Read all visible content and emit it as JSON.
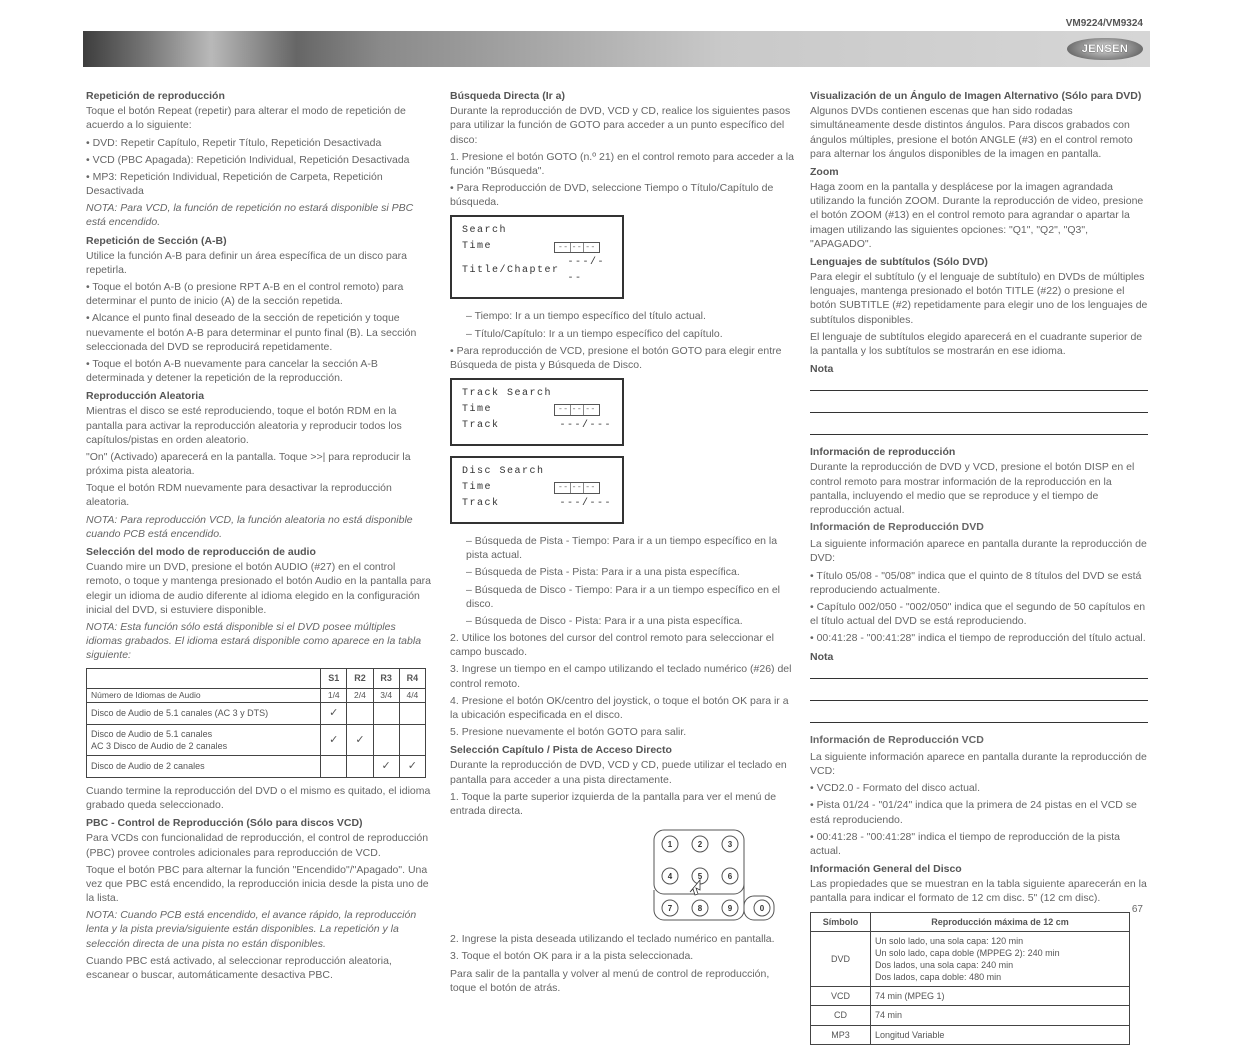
{
  "header": {
    "brand": "JENSEN",
    "model": "VM9224/VM9324"
  },
  "col1": {
    "heading_repeat": "Repetición de reproducción",
    "repeat_p1": "Toque el botón Repeat (repetir) para alterar el modo de repetición de acuerdo a lo siguiente:",
    "repeat_li1": "DVD: Repetir Capítulo, Repetir Título, Repetición Desactivada",
    "repeat_li2": "VCD (PBC Apagada): Repetición Individual, Repetición Desactivada",
    "repeat_li3": "MP3: Repetición Individual, Repetición de Carpeta, Repetición Desactivada",
    "repeat_note": "NOTA: Para VCD, la función de repetición no estará disponible si PBC está encendido.",
    "heading_section": "Repetición de Sección (A-B)",
    "section_p": "Utilice la función A-B para definir un área específica de un disco para repetirla.",
    "section_li1": "Toque el botón A-B (o presione RPT A-B en el control remoto) para determinar el punto de inicio (A) de la sección repetida.",
    "section_li2": "Alcance el punto final deseado de la sección de repetición y toque nuevamente el botón A-B para determinar el punto final (B). La sección seleccionada del DVD se reproducirá repetidamente.",
    "section_li3": "Toque el botón A-B nuevamente para cancelar la sección A-B determinada y detener la repetición de la reproducción.",
    "heading_random": "Reproducción Aleatoria",
    "random_p1": "Mientras el disco se esté reproduciendo, toque el botón RDM en la pantalla para activar la reproducción aleatoria y reproducir todos los capítulos/pistas en orden aleatorio.",
    "random_p2": "\"On\" (Activado) aparecerá en la pantalla. Toque >>| para reproducir la próxima pista aleatoria.",
    "random_p3": "Toque el botón RDM nuevamente para desactivar la reproducción aleatoria.",
    "random_note": "NOTA: Para reproducción VCD, la función aleatoria no está disponible cuando PCB está encendido.",
    "heading_a": "Selección del modo de reproducción de audio",
    "a_p1": "Cuando mire un DVD, presione el botón AUDIO (#27) en el control remoto, o toque y mantenga presionado el botón Audio en la pantalla para elegir un idioma de audio diferente al idioma elegido en la configuración inicial del DVD, si estuviere disponible.",
    "a_note": "NOTA: Esta función sólo está disponible si el DVD posee múltiples idiomas grabados. El idioma estará disponible como aparece en la tabla siguiente:",
    "table": {
      "head": [
        "",
        "S1",
        "R2",
        "R3",
        "R4"
      ],
      "label_row_head": "Número de Idiomas de Audio",
      "label_row": [
        "1/4",
        "2/4",
        "3/4",
        "4/4"
      ],
      "rows": [
        {
          "li": [
            "Disco de Audio de 5.1 canales (AC 3 y DTS)"
          ],
          "c": [
            "✓",
            "",
            "",
            ""
          ]
        },
        {
          "li": [
            "Disco de Audio de 5.1 canales",
            "AC 3 Disco de Audio de 2 canales"
          ],
          "c": [
            "✓",
            "✓",
            "",
            ""
          ]
        },
        {
          "li": [
            "Disco de Audio de 2 canales"
          ],
          "c": [
            "",
            "",
            "✓",
            "✓"
          ]
        }
      ]
    },
    "a_p2": "Cuando termine la reproducción del DVD o el mismo es quitado, el idioma grabado queda seleccionado.",
    "heading_pbc": "PBC - Control de Reproducción (Sólo para discos VCD)",
    "pbc_p1": "Para VCDs con funcionalidad de reproducción, el control de reproducción (PBC) provee controles adicionales para reproducción de VCD.",
    "pbc_p2": "Toque el botón PBC para alternar la función \"Encendido\"/\"Apagado\". Una vez que PBC está encendido, la reproducción inicia desde la pista uno de la lista.",
    "pbc_note": "NOTA: Cuando PCB está encendido, el avance rápido, la reproducción lenta y la pista previa/siguiente están disponibles. La repetición y la selección directa de una pista no están disponibles.",
    "pbc_p3": "Cuando PBC está activado, al seleccionar reproducción aleatoria, escanear o buscar, automáticamente desactiva PBC."
  },
  "col2": {
    "heading_goto": "Búsqueda Directa (Ir a)",
    "goto_p1": "Durante la reproducción de DVD, VCD y CD, realice los siguientes pasos para utilizar la función de GOTO para acceder a un punto específico del disco:",
    "goto_li1": "Presione el botón GOTO (n.º 21) en el control remoto para acceder a la función \"Búsqueda\".",
    "goto_dvdline": "Para Reproducción de DVD, seleccione Tiempo o Título/Capítulo de búsqueda.",
    "osd1": {
      "title": "Search",
      "time": "Time",
      "field": "-- -- --",
      "tc": "Title/Chapter",
      "tcval": "---/---"
    },
    "goto_dvd_sub1": "Tiempo: Ir a un tiempo específico del título actual.",
    "goto_dvd_sub2": "Título/Capítulo: Ir a un tiempo específico del capítulo.",
    "goto_vcdline": "Para reproducción de VCD, presione el botón GOTO para elegir entre Búsqueda de pista y Búsqueda de Disco.",
    "osd2": {
      "title": "Track Search",
      "time": "Time",
      "track": "Track",
      "tv": "---/---"
    },
    "osd3": {
      "title": "Disc Search",
      "time": "Time",
      "track": "Track",
      "tv": "---/---"
    },
    "goto_vcd_sub1": "Búsqueda de Pista - Tiempo: Para ir a un tiempo específico en la pista actual.",
    "goto_vcd_sub2": "Búsqueda de Pista - Pista: Para ir a una pista específica.",
    "goto_vcd_sub3": "Búsqueda de Disco - Tiempo: Para ir a un tiempo específico en el disco.",
    "goto_vcd_sub4": "Búsqueda de Disco - Pista: Para ir a una pista específica.",
    "goto_li2": "Utilice los botones del cursor del control remoto para seleccionar el campo buscado.",
    "goto_li3": "Ingrese un tiempo en el campo utilizando el teclado numérico (#26) del control remoto.",
    "goto_li4": "Presione el botón OK/centro del joystick, o toque el botón OK para ir a la ubicación especificada en el disco.",
    "goto_li5": "Presione nuevamente el botón GOTO para salir.",
    "heading_direct": "Selección Capítulo / Pista de Acceso Directo",
    "direct_p": "Durante la reproducción de DVD, VCD y CD, puede utilizar el teclado en pantalla para acceder a una pista directamente.",
    "direct_li1": "Toque la parte superior izquierda de la pantalla para ver el menú de entrada directa.",
    "direct_li2": "Ingrese la pista deseada utilizando el teclado numérico en pantalla.",
    "direct_li3": "Toque el botón OK para ir a la pista seleccionada.",
    "direct_exit": "Para salir de la pantalla y volver al menú de control de reproducción, toque el botón de atrás."
  },
  "col3": {
    "heading_alt": "Visualización de un Ángulo de Imagen Alternativo (Sólo para DVD)",
    "alt_p": "Algunos DVDs contienen escenas que han sido rodadas simultáneamente desde distintos ángulos. Para discos grabados con ángulos múltiples, presione el botón ANGLE (#3) en el control remoto para alternar los ángulos disponibles de la imagen en pantalla.",
    "heading_zoom": "Zoom",
    "zoom_p": "Haga zoom en la pantalla y desplácese por la imagen agrandada utilizando la función ZOOM. Durante la reproducción de video, presione el botón ZOOM (#13) en el control remoto para agrandar o apartar la imagen utilizando las siguientes opciones: \"Q1\", \"Q2\", \"Q3\", \"APAGADO\".",
    "heading_lang": "Lenguajes de subtítulos (Sólo DVD)",
    "lang_p": "Para elegir el subtítulo (y el lenguaje de subtítulo) en DVDs de múltiples lenguajes, mantenga presionado el botón TITLE (#22) o presione el botón SUBTITLE (#2) repetidamente para elegir uno de los lenguajes de subtítulos disponibles.",
    "lang_p2": "El lenguaje de subtítulos elegido aparecerá en el cuadrante superior de la pantalla y los subtítulos se mostrarán en ese idioma.",
    "heading_memo": "Nota",
    "heading_info": "Información de reproducción",
    "info_p1": "Durante la reproducción de DVD y VCD, presione el botón DISP en el control remoto para mostrar información de la reproducción en la pantalla, incluyendo el medio que se reproduce y el tiempo de reproducción actual.",
    "info_dvd_h": "Información de Reproducción DVD",
    "info_dvd_p": "La siguiente información aparece en pantalla durante la reproducción de DVD:",
    "info_dvd_li1": "Título 05/08 - \"05/08\" indica que el quinto de 8 títulos del DVD se está reproduciendo actualmente.",
    "info_dvd_li2": "Capítulo 002/050 - \"002/050\" indica que el segundo de 50 capítulos en el título actual del DVD se está reproduciendo.",
    "info_dvd_li3": "00:41:28 - \"00:41:28\" indica el tiempo de reproducción del título actual.",
    "info_vcd_h": "Información de Reproducción VCD",
    "info_vcd_p": "La siguiente información aparece en pantalla durante la reproducción de VCD:",
    "info_vcd_li1": "VCD2.0 - Formato del disco actual.",
    "info_vcd_li2": "Pista 01/24 - \"01/24\" indica que la primera de 24 pistas en el VCD se está reproduciendo.",
    "info_vcd_li3": "00:41:28 - \"00:41:28\" indica el tiempo de reproducción de la pista actual.",
    "heading_memo2": "Nota",
    "heading_gen": "Información General del Disco",
    "gen_p": "Las propiedades que se muestran en la tabla siguiente aparecerán en la pantalla para indicar el formato de 12 cm disc. 5\" (12 cm disc).",
    "gen_t": {
      "head": [
        "Símbolo",
        "Reproducción máxima de 12 cm"
      ],
      "rows": [
        [
          "DVD",
          "Un solo lado, una sola capa: 120 min\nUn solo lado, capa doble (MPPEG 2): 240 min\nDos lados, una sola capa: 240 min\nDos lados, capa doble: 480 min"
        ],
        [
          "VCD",
          "74 min (MPEG 1)"
        ],
        [
          "CD",
          "74 min"
        ],
        [
          "MP3",
          "Longitud Variable"
        ]
      ]
    }
  },
  "page_number": "67"
}
